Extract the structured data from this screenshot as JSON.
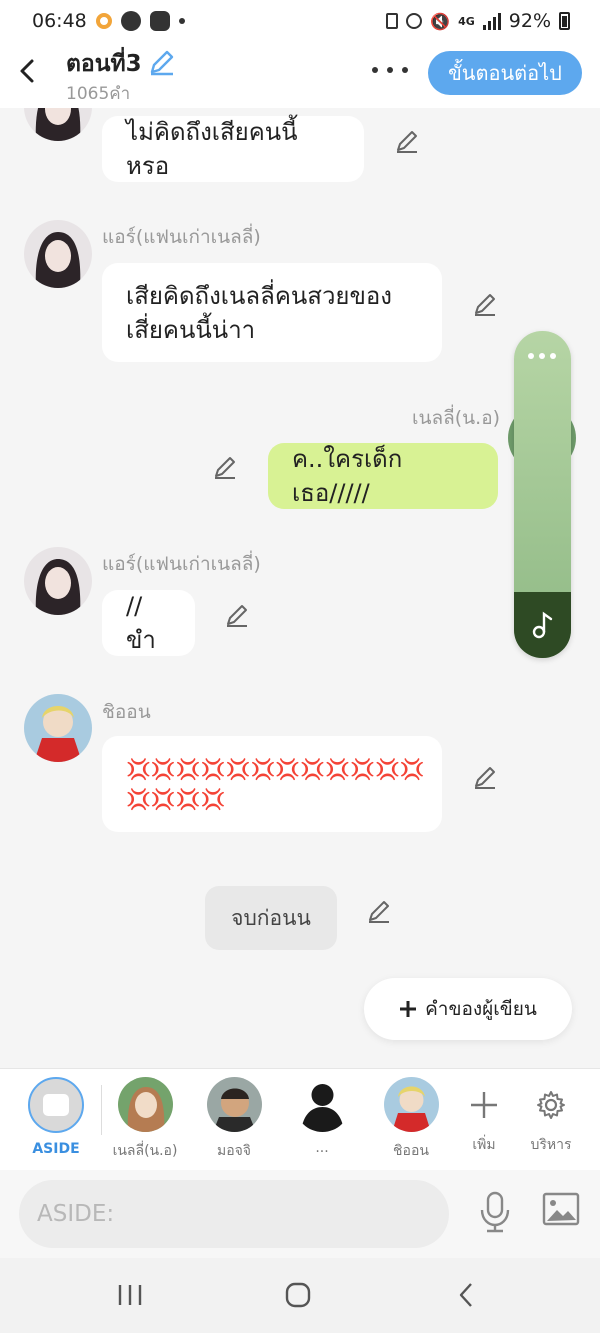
{
  "status_bar": {
    "time": "06:48",
    "battery": "92%",
    "network": "4G"
  },
  "header": {
    "title": "ตอนที่3",
    "word_count": "1065คำ",
    "next_button": "ขั้นตอนต่อไป"
  },
  "messages": [
    {
      "speaker": "",
      "text": "ไม่คิดถึงเสียคนนี้หรอ"
    },
    {
      "speaker": "แอร์(แฟนเก่าเนลลี่)",
      "text_lines": [
        "เสียคิดถึงเนลลี่คนสวยของ",
        "เสี่ยคนนี้น่าา"
      ]
    },
    {
      "speaker": "เนลลี่(น.อ)",
      "text": "ค..ใครเด็กเธอ/////"
    },
    {
      "speaker": "แอร์(แฟนเก่าเนลลี่)",
      "text": "//ขำ"
    },
    {
      "speaker": "ชิออน",
      "text_lines": [
        "💢💢💢💢💢💢💢💢💢💢💢💢",
        "💢💢💢💢"
      ]
    }
  ],
  "narration": {
    "text": "จบก่อนน"
  },
  "writer_note_button": {
    "label": "คำของผู้เขียน"
  },
  "characters": [
    {
      "label": "ASIDE",
      "active": true
    },
    {
      "label": "เนลลี่(น.อ)"
    },
    {
      "label": "มอจจิ"
    },
    {
      "label": "..."
    },
    {
      "label": "ชิออน"
    },
    {
      "label": "เพิ่ม"
    },
    {
      "label": "บริหาร"
    }
  ],
  "input": {
    "placeholder": "ASIDE:"
  },
  "colors": {
    "accent": "#5da8ee",
    "my_bubble": "#d8f294",
    "music_panel": "#9cc48e"
  }
}
